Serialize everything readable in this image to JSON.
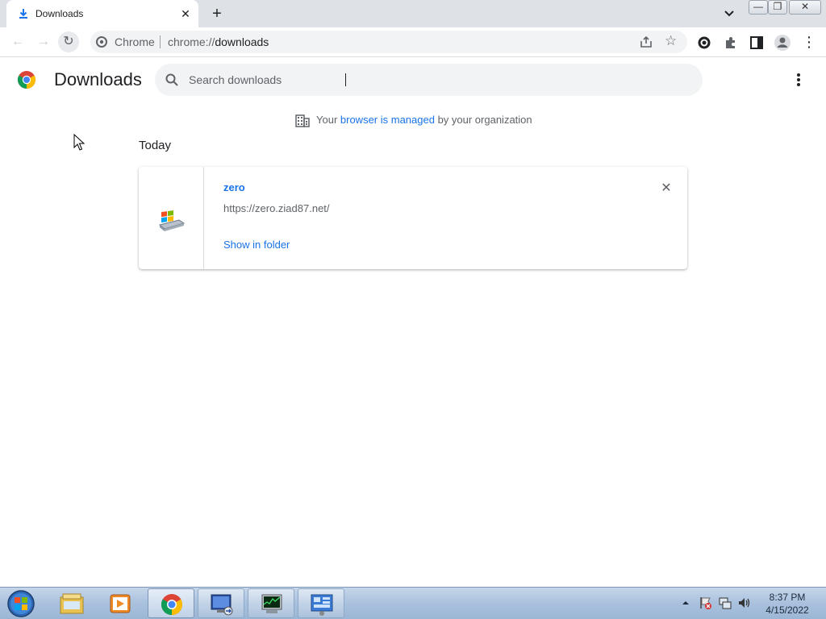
{
  "browser": {
    "tab": {
      "title": "Downloads",
      "close_glyph": "✕"
    },
    "new_tab_glyph": "+",
    "window_controls": {
      "minimize": "—",
      "restore": "❐",
      "close": "✕"
    },
    "toolbar": {
      "back_glyph": "←",
      "forward_glyph": "→",
      "reload_glyph": "↻",
      "menu_glyph": "⋮"
    },
    "omnibox": {
      "chip": "Chrome",
      "scheme": "chrome://",
      "path": "downloads",
      "bookmark_glyph": "☆"
    }
  },
  "page": {
    "title": "Downloads",
    "search": {
      "placeholder": "Search downloads",
      "value": ""
    },
    "managed": {
      "before": "Your ",
      "link": "browser is managed",
      "after": " by your organization"
    },
    "date_header": "Today",
    "downloads": [
      {
        "name": "zero",
        "url": "https://zero.ziad87.net/",
        "action": "Show in folder",
        "remove_glyph": "✕",
        "icon": "windows-installer-icon"
      }
    ]
  },
  "taskbar": {
    "items": [
      {
        "icon": "file-explorer-icon"
      },
      {
        "icon": "media-player-icon"
      },
      {
        "icon": "chrome-icon"
      },
      {
        "icon": "remote-desktop-icon"
      },
      {
        "icon": "task-manager-icon"
      },
      {
        "icon": "control-panel-icon"
      }
    ],
    "clock": {
      "time": "8:37 PM",
      "date": "4/15/2022"
    }
  },
  "colors": {
    "accent": "#1a73e8",
    "tabstrip": "#dee1e6",
    "secondary_text": "#5f6368"
  }
}
